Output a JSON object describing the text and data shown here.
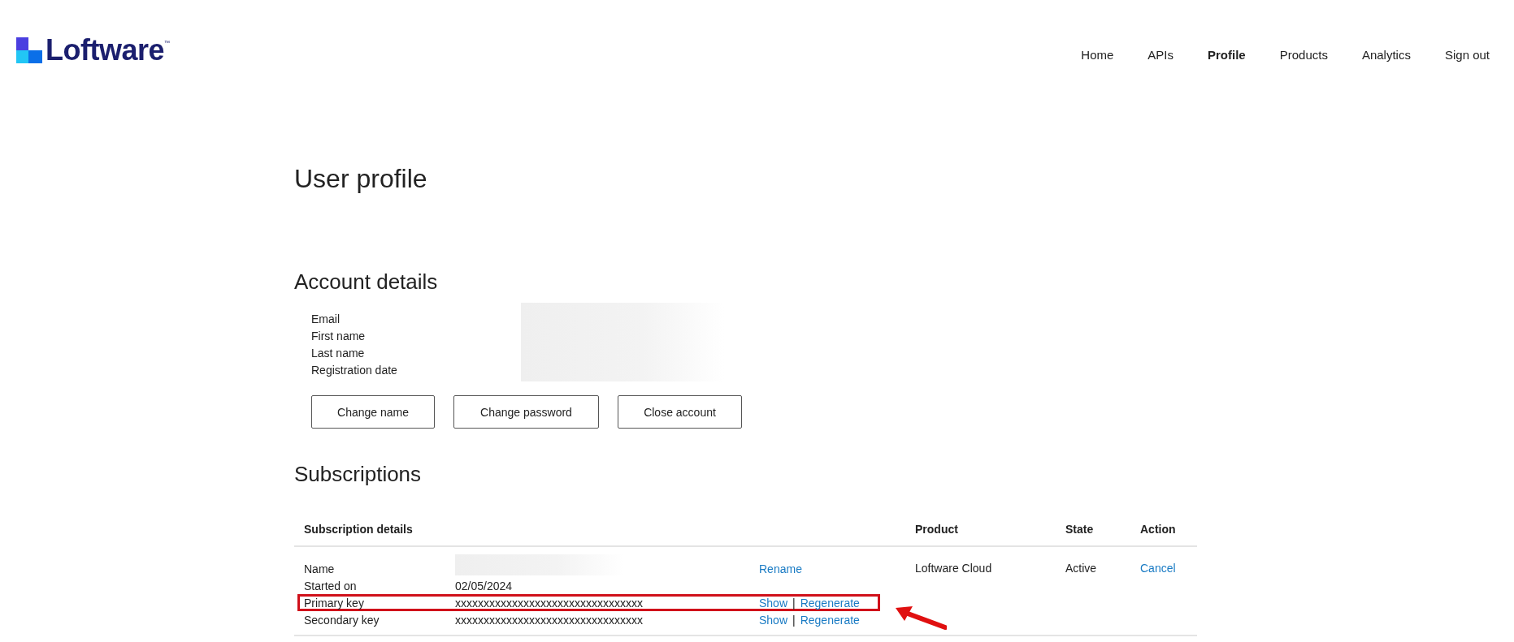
{
  "brand": {
    "name": "Loftware",
    "mark": "™"
  },
  "nav": [
    {
      "label": "Home",
      "selected": false
    },
    {
      "label": "APIs",
      "selected": false
    },
    {
      "label": "Profile",
      "selected": true
    },
    {
      "label": "Products",
      "selected": false
    },
    {
      "label": "Analytics",
      "selected": false
    },
    {
      "label": "Sign out",
      "selected": false
    }
  ],
  "page_title": "User profile",
  "account": {
    "title": "Account details",
    "fields": [
      "Email",
      "First name",
      "Last name",
      "Registration date"
    ],
    "buttons": [
      "Change name",
      "Change password",
      "Close account"
    ]
  },
  "subscriptions": {
    "title": "Subscriptions",
    "columns": [
      "Subscription details",
      "Product",
      "State",
      "Action"
    ],
    "rows": [
      {
        "product": "Loftware Cloud",
        "state": "Active",
        "action": "Cancel",
        "details": [
          {
            "label": "Name",
            "value_blurred": true,
            "actions": [
              "Rename"
            ],
            "highlighted": false
          },
          {
            "label": "Started on",
            "value_blurred": false,
            "value": "02/05/2024",
            "highlighted": false
          },
          {
            "label": "Primary key",
            "value_blurred": false,
            "value": "xxxxxxxxxxxxxxxxxxxxxxxxxxxxxxxxx",
            "actions": [
              "Show",
              "Regenerate"
            ],
            "separator": "|",
            "highlighted": true
          },
          {
            "label": "Secondary key",
            "value_blurred": false,
            "value": "xxxxxxxxxxxxxxxxxxxxxxxxxxxxxxxxx",
            "actions": [
              "Show",
              "Regenerate"
            ],
            "separator": "|",
            "highlighted": false
          }
        ]
      }
    ]
  }
}
